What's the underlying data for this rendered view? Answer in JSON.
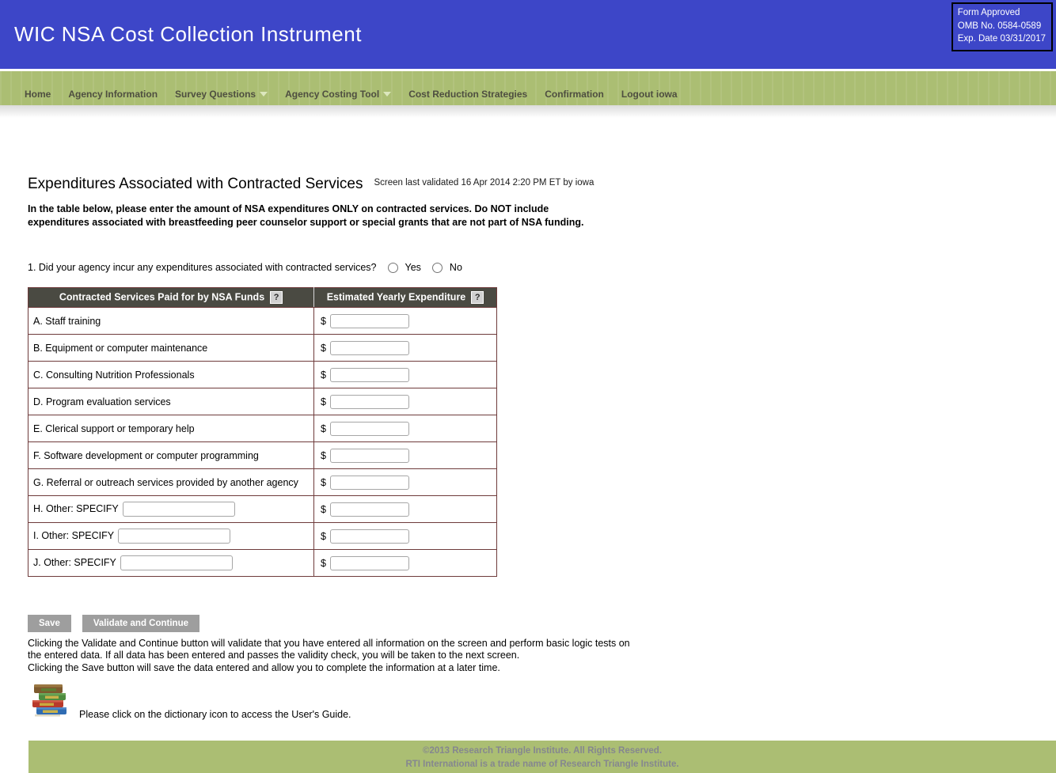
{
  "header": {
    "title": "WIC NSA Cost Collection Instrument",
    "form_approved": {
      "line1": "Form Approved",
      "line2": "OMB No. 0584-0589",
      "line3": "Exp. Date 03/31/2017"
    }
  },
  "nav": {
    "items": [
      {
        "label": "Home",
        "has_dropdown": false
      },
      {
        "label": "Agency Information",
        "has_dropdown": false
      },
      {
        "label": "Survey Questions",
        "has_dropdown": true
      },
      {
        "label": "Agency Costing Tool",
        "has_dropdown": true
      },
      {
        "label": "Cost Reduction Strategies",
        "has_dropdown": false
      },
      {
        "label": "Confirmation",
        "has_dropdown": false
      },
      {
        "label": "Logout iowa",
        "has_dropdown": false
      }
    ]
  },
  "page": {
    "title": "Expenditures Associated with Contracted Services",
    "last_validated": "Screen last validated 16 Apr 2014 2:20 PM ET by iowa",
    "instructions": "In the table below, please enter the amount of NSA expenditures ONLY on contracted services. Do NOT include\nexpenditures associated with breastfeeding peer counselor support or special grants that are not part of NSA funding.",
    "question1": {
      "text": "1. Did your agency incur any expenditures associated with contracted services?",
      "option_yes": "Yes",
      "option_no": "No"
    }
  },
  "table": {
    "help_label": "?",
    "currency_symbol": "$",
    "headers": [
      {
        "label": "Contracted Services Paid for by NSA Funds"
      },
      {
        "label": "Estimated Yearly Expenditure"
      }
    ],
    "rows": [
      {
        "label": "A. Staff training",
        "has_specify": false,
        "value": ""
      },
      {
        "label": "B. Equipment or computer maintenance",
        "has_specify": false,
        "value": ""
      },
      {
        "label": "C. Consulting Nutrition Professionals",
        "has_specify": false,
        "value": ""
      },
      {
        "label": "D. Program evaluation services",
        "has_specify": false,
        "value": ""
      },
      {
        "label": "E. Clerical support or temporary help",
        "has_specify": false,
        "value": ""
      },
      {
        "label": "F. Software development or computer programming",
        "has_specify": false,
        "value": ""
      },
      {
        "label": "G. Referral or outreach services provided by another agency",
        "has_specify": false,
        "value": ""
      },
      {
        "label": "H. Other: SPECIFY",
        "has_specify": true,
        "specify_value": "",
        "value": ""
      },
      {
        "label": "I. Other: SPECIFY",
        "has_specify": true,
        "specify_value": "",
        "value": ""
      },
      {
        "label": "J. Other: SPECIFY",
        "has_specify": true,
        "specify_value": "",
        "value": ""
      }
    ]
  },
  "actions": {
    "save": "Save",
    "validate": "Validate and Continue",
    "description": "Clicking the Validate and Continue button will validate that you have entered all information on the screen and perform basic logic tests on\nthe entered data. If all data has been entered and passes the validity check, you will be taken to the next screen.\nClicking the Save button will save the data entered and allow you to complete the information at a later time."
  },
  "dictionary_note": "Please click on the dictionary icon to access the User's Guide.",
  "footer": {
    "line1": "©2013 Research Triangle Institute. All Rights Reserved.",
    "line2": "RTI International is a trade name of Research Triangle Institute."
  },
  "colors": {
    "header_blue": "#3d46c8",
    "nav_green": "#abbe73",
    "table_border_maroon": "#6e3b3b",
    "table_header_gray": "#4a4a42",
    "button_gray": "#9e9e9e",
    "footer_text_gray": "#85878f"
  }
}
